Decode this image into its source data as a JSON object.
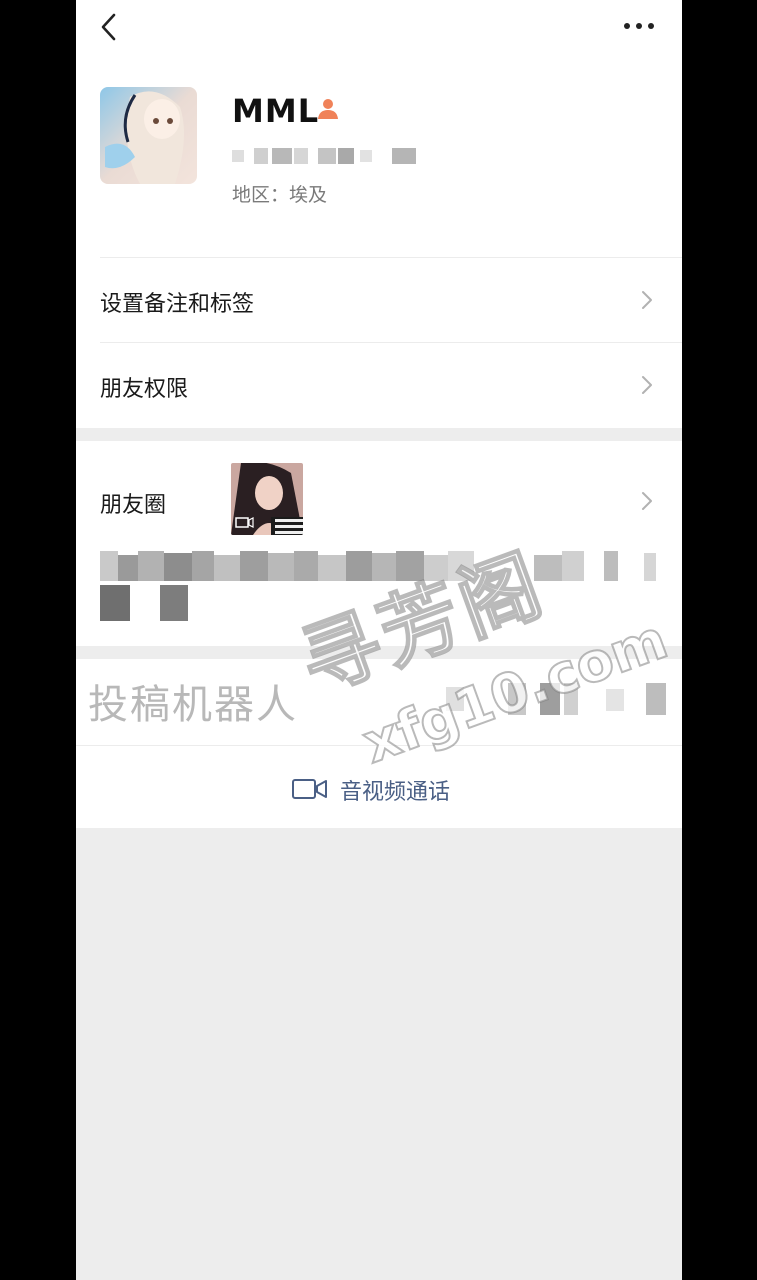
{
  "profile": {
    "name": "MML",
    "region": "地区：埃及"
  },
  "rows": {
    "remark_tags": "设置备注和标签",
    "friend_permissions": "朋友权限",
    "moments": "朋友圈"
  },
  "overlay": {
    "watermark_text": "投稿机器人"
  },
  "actions": {
    "av_call": "音视频通话"
  },
  "watermark": {
    "brand": "寻芳阁",
    "domain": "xfg10.com"
  },
  "icons": {
    "back": "chevron-left-icon",
    "more": "more-dots-icon",
    "person": "person-icon",
    "chevron": "chevron-right-icon",
    "video": "video-camera-icon"
  },
  "colors": {
    "accent_link": "#4a5f85",
    "person_icon": "#f08259",
    "background": "#ededed"
  }
}
